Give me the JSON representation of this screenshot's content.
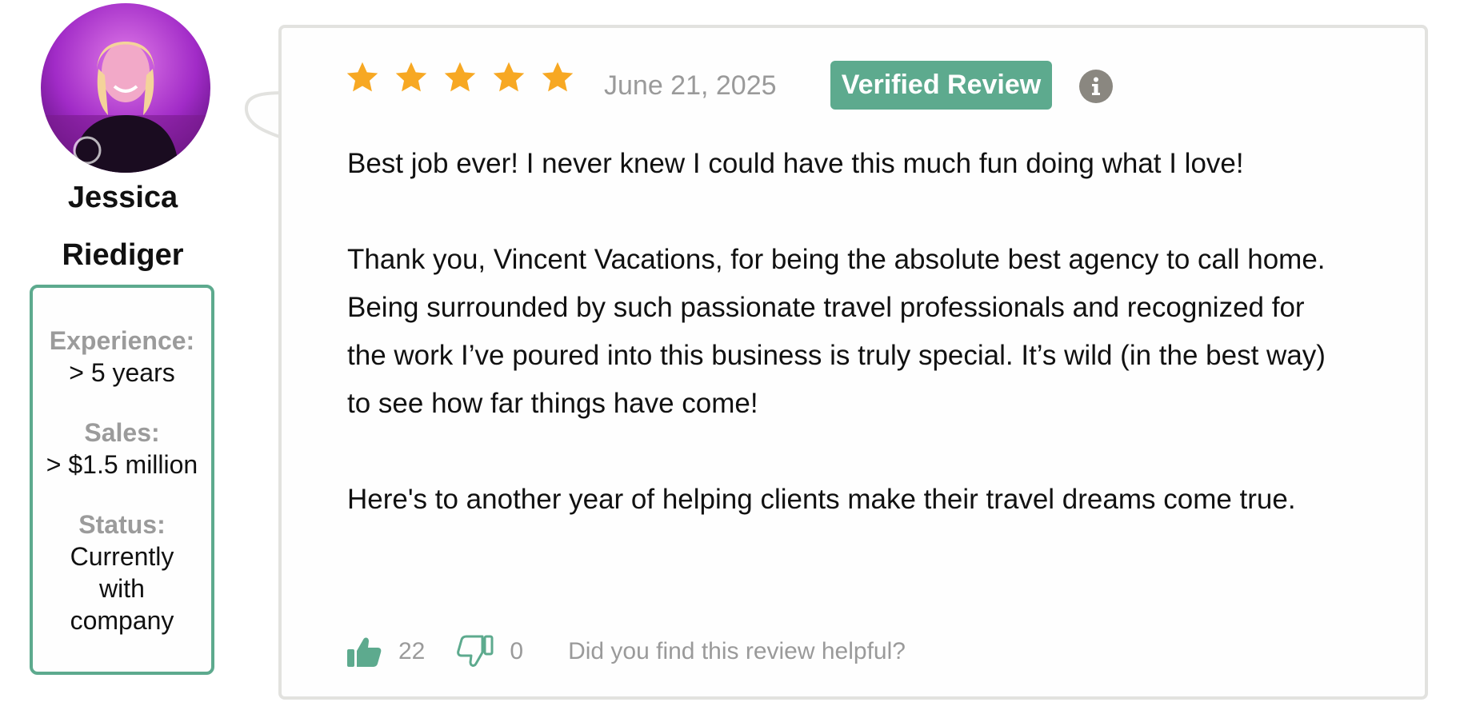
{
  "reviewer": {
    "name_line1": "Jessica",
    "name_line2": "Riediger",
    "stats": [
      {
        "label": "Experience:",
        "value": "> 5 years"
      },
      {
        "label": "Sales:",
        "value": "> $1.5 million"
      },
      {
        "label": "Status:",
        "value": "Currently with company"
      }
    ]
  },
  "review": {
    "rating": 5,
    "max_rating": 5,
    "date": "June 21, 2025",
    "badge": "Verified Review",
    "paragraphs": [
      "Best job ever! I never knew I could have this much fun doing what I love!",
      "Thank you, Vincent Vacations, for being the absolute best agency to call home. Being surrounded by such passionate travel professionals and recognized for the work I’ve poured into this business is truly special. It’s wild (in the best way) to see how far things have come!",
      "Here's to another year of helping clients make their travel dreams come true."
    ],
    "helpful": {
      "up_count": "22",
      "down_count": "0",
      "prompt": "Did you find this review helpful?"
    }
  },
  "colors": {
    "accent": "#5daa8e",
    "star": "#f7a823",
    "muted_text": "#9a9a9a",
    "card_border": "#e2e2df",
    "info_icon": "#8a8780"
  },
  "icons": {
    "info": "info-icon",
    "star": "star-icon",
    "thumbs_up": "thumbs-up-icon",
    "thumbs_down": "thumbs-down-icon"
  }
}
